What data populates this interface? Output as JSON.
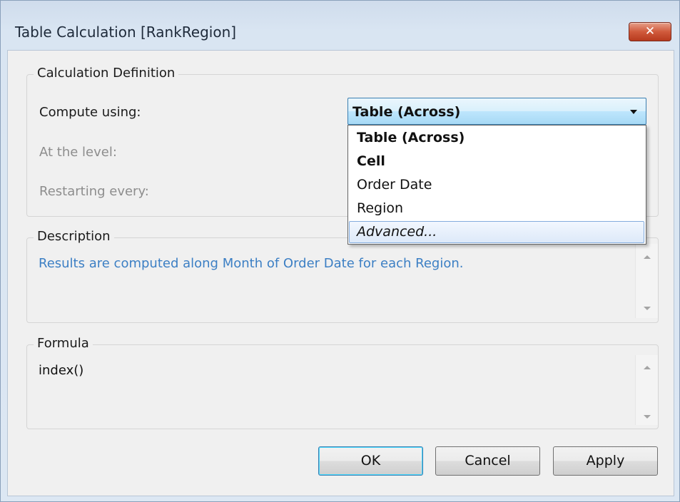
{
  "window": {
    "title": "Table Calculation [RankRegion]",
    "close_glyph": "✕"
  },
  "calculation_definition": {
    "legend": "Calculation Definition",
    "compute_using_label": "Compute using:",
    "at_the_level_label": "At the level:",
    "restarting_every_label": "Restarting every:",
    "compute_using": {
      "selected": "Table (Across)",
      "options": [
        {
          "label": "Table (Across)",
          "style": "bold"
        },
        {
          "label": "Cell",
          "style": "bold"
        },
        {
          "label": "Order Date",
          "style": "normal"
        },
        {
          "label": "Region",
          "style": "normal"
        },
        {
          "label": "Advanced...",
          "style": "italic",
          "highlighted": true
        }
      ]
    }
  },
  "description": {
    "legend": "Description",
    "text": "Results are computed along Month of Order Date for each Region."
  },
  "formula": {
    "legend": "Formula",
    "text": "index()"
  },
  "buttons": {
    "ok": "OK",
    "cancel": "Cancel",
    "apply": "Apply"
  },
  "icons": {
    "close": "close-icon",
    "dropdown": "chevron-down-icon",
    "scroll_up": "scroll-up-icon",
    "scroll_down": "scroll-down-icon"
  },
  "colors": {
    "description_text": "#3c7fc4",
    "close_button": "#c7492d",
    "combo_focus": "#3c7fb1"
  }
}
